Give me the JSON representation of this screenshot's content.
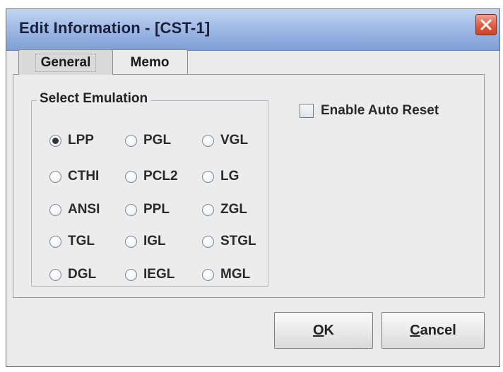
{
  "window": {
    "title": "Edit Information - [CST-1]"
  },
  "tabs": [
    {
      "label": "General",
      "selected": true
    },
    {
      "label": "Memo",
      "selected": false
    }
  ],
  "emulation": {
    "group_label": "Select Emulation",
    "selected": "LPP",
    "options": [
      "LPP",
      "PGL",
      "VGL",
      "CTHI",
      "PCL2",
      "LG",
      "ANSI",
      "PPL",
      "ZGL",
      "TGL",
      "IGL",
      "STGL",
      "DGL",
      "IEGL",
      "MGL"
    ]
  },
  "auto_reset": {
    "label": "Enable Auto Reset",
    "checked": false
  },
  "buttons": {
    "ok": {
      "mnemonic": "O",
      "rest": "K"
    },
    "cancel": {
      "mnemonic": "C",
      "rest": "ancel"
    }
  }
}
